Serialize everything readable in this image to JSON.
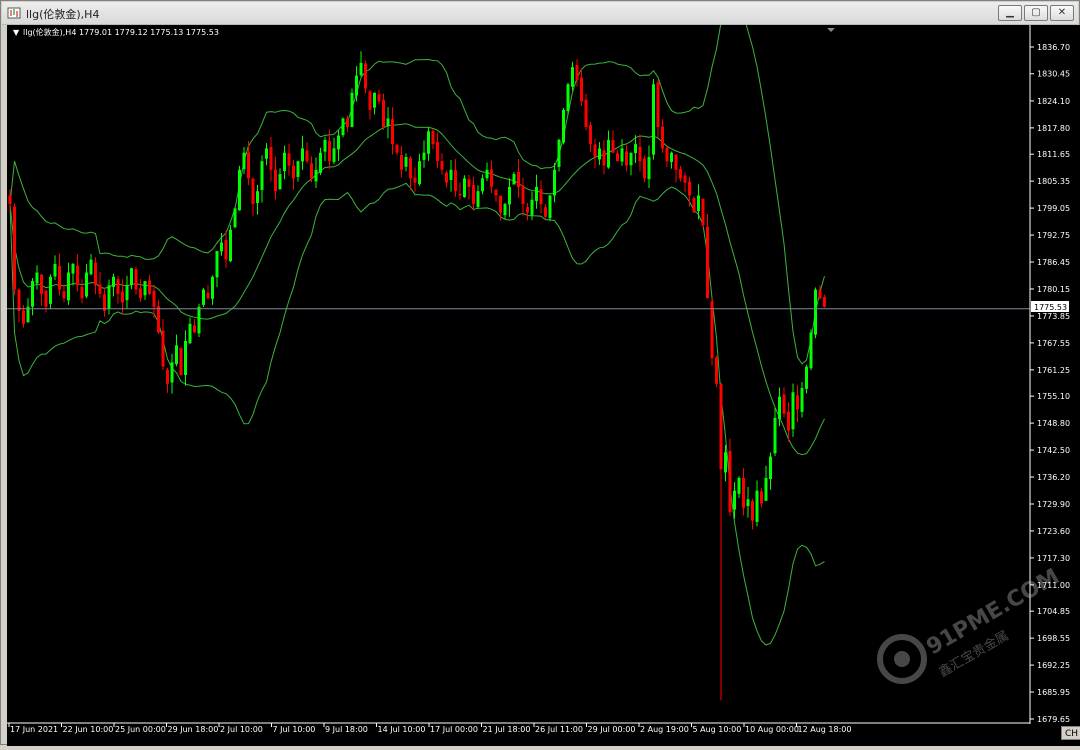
{
  "window": {
    "title": "llg(伦敦金),H4",
    "minimize_label": "▁",
    "maximize_label": "▢",
    "close_label": "✕"
  },
  "chart": {
    "header_text": "llg(伦敦金),H4  1779.01 1779.12 1775.13 1775.53",
    "current_price_label": "1775.53",
    "tab_stub_label": "CH",
    "colors": {
      "background": "#000000",
      "bull": "#00ff00",
      "bear": "#ff0000",
      "bands": "#3cb43c",
      "axis_text": "#ffffff",
      "price_line": "#7a8a99"
    },
    "watermark": {
      "main": "91PME.COM",
      "sub": "鑫汇宝贵金属"
    }
  },
  "chart_data": {
    "type": "candlestick",
    "symbol": "llg",
    "timeframe": "H4",
    "last_bar": {
      "open": 1779.01,
      "high": 1779.12,
      "low": 1775.13,
      "close": 1775.53
    },
    "y_ticks": [
      "1836.70",
      "1830.45",
      "1824.10",
      "1817.80",
      "1811.65",
      "1805.35",
      "1799.05",
      "1792.75",
      "1786.45",
      "1780.15",
      "1773.85",
      "1767.55",
      "1761.25",
      "1755.10",
      "1748.80",
      "1742.50",
      "1736.20",
      "1729.90",
      "1723.60",
      "1717.30",
      "1711.00",
      "1704.85",
      "1698.55",
      "1692.25",
      "1685.95",
      "1679.65"
    ],
    "x_ticks": [
      "17 Jun 2021",
      "22 Jun 10:00",
      "25 Jun 00:00",
      "29 Jun 18:00",
      "2 Jul 10:00",
      "7 Jul 10:00",
      "9 Jul 18:00",
      "14 Jul 10:00",
      "17 Jul 00:00",
      "21 Jul 18:00",
      "26 Jul 11:00",
      "29 Jul 00:00",
      "2 Aug 19:00",
      "5 Aug 10:00",
      "10 Aug 00:00",
      "12 Aug 18:00"
    ],
    "closes": [
      1800,
      1780,
      1775,
      1772,
      1776,
      1782,
      1784,
      1779,
      1776,
      1783,
      1786,
      1780,
      1778,
      1784,
      1786,
      1781,
      1778,
      1784,
      1787,
      1781,
      1779,
      1775,
      1781,
      1783,
      1779,
      1777,
      1781,
      1785,
      1780,
      1778,
      1782,
      1779,
      1776,
      1770,
      1762,
      1758,
      1763,
      1767,
      1760,
      1768,
      1772,
      1770,
      1776,
      1780,
      1778,
      1783,
      1789,
      1791,
      1787,
      1794,
      1799,
      1808,
      1812,
      1806,
      1800,
      1803,
      1810,
      1813,
      1808,
      1803,
      1807,
      1812,
      1809,
      1806,
      1810,
      1813,
      1810,
      1806,
      1808,
      1812,
      1815,
      1810,
      1813,
      1816,
      1820,
      1818,
      1826,
      1830,
      1833,
      1827,
      1822,
      1826,
      1824,
      1818,
      1820,
      1814,
      1812,
      1808,
      1811,
      1806,
      1805,
      1810,
      1812,
      1817,
      1814,
      1810,
      1808,
      1805,
      1808,
      1803,
      1802,
      1806,
      1804,
      1800,
      1803,
      1806,
      1808,
      1804,
      1802,
      1798,
      1800,
      1804,
      1807,
      1804,
      1800,
      1798,
      1801,
      1804,
      1800,
      1797,
      1802,
      1808,
      1815,
      1822,
      1828,
      1832,
      1829,
      1824,
      1818,
      1814,
      1811,
      1813,
      1809,
      1815,
      1812,
      1810,
      1813,
      1809,
      1812,
      1814,
      1810,
      1806,
      1811,
      1828,
      1818,
      1813,
      1810,
      1812,
      1808,
      1806,
      1805,
      1802,
      1798,
      1802,
      1795,
      1778,
      1764,
      1758,
      1738,
      1742,
      1728,
      1733,
      1736,
      1729,
      1731,
      1726,
      1733,
      1730,
      1736,
      1741,
      1750,
      1755,
      1751,
      1747,
      1756,
      1752,
      1757,
      1762,
      1770,
      1780,
      1778,
      1776
    ]
  }
}
